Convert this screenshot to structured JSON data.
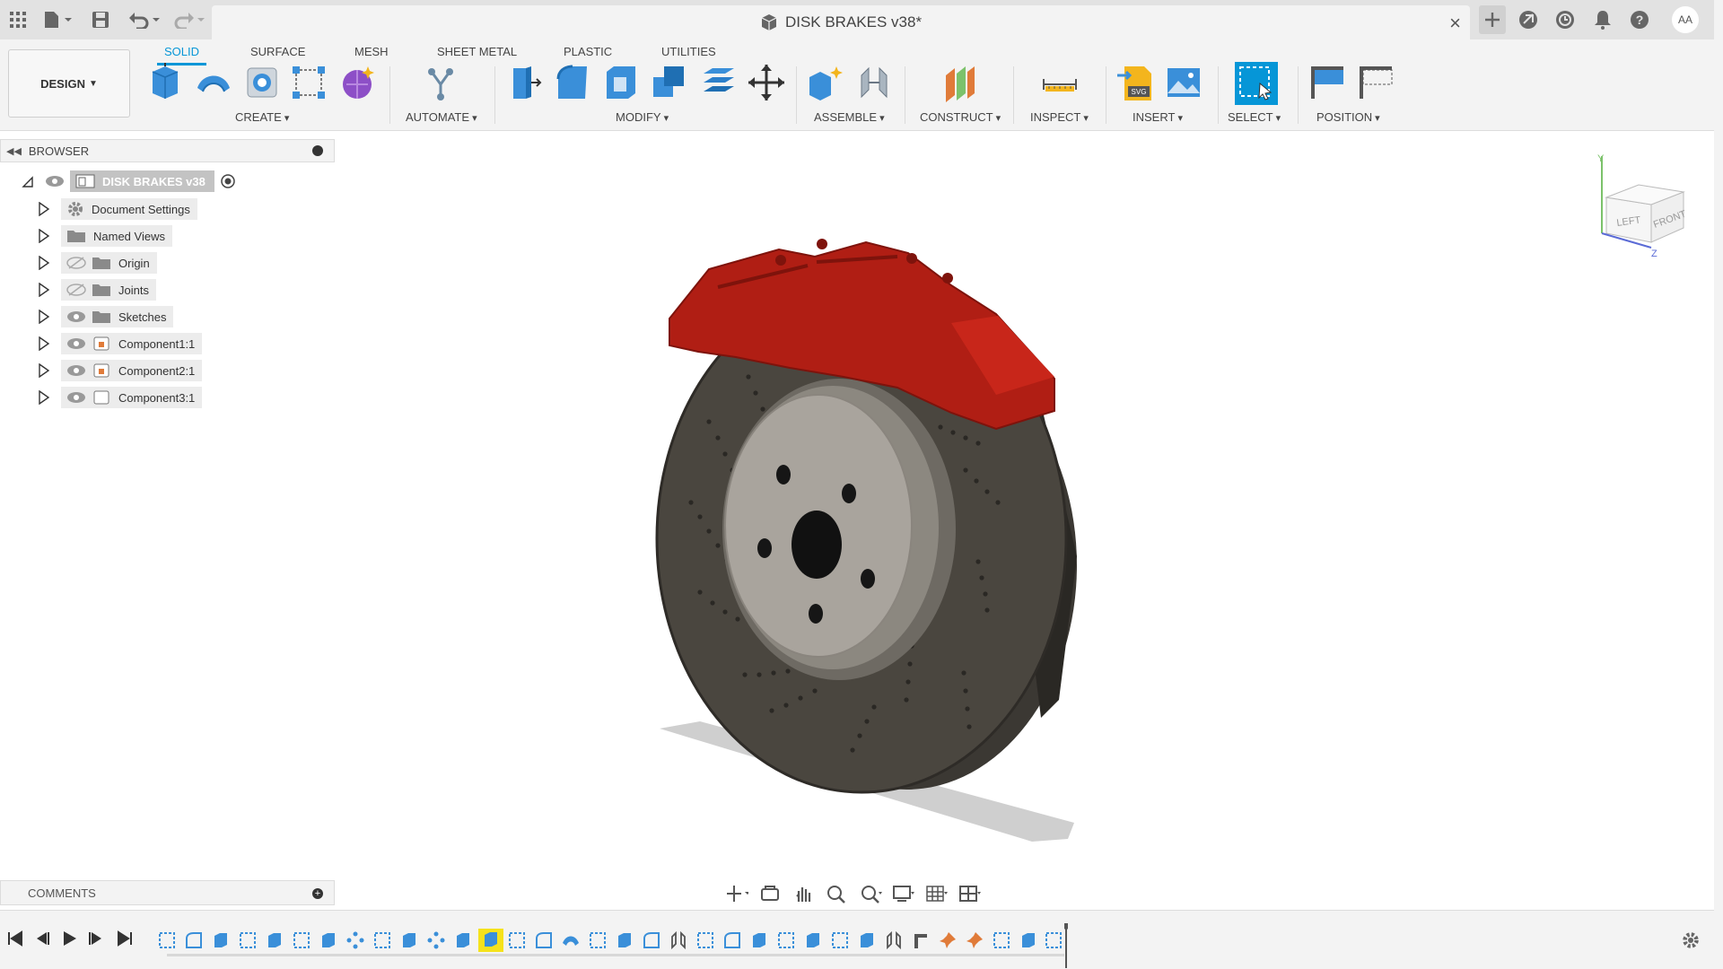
{
  "topbar": {
    "doc_title": "DISK BRAKES v38*",
    "close_label": "×",
    "avatar_initials": "AA"
  },
  "ribbon": {
    "workspace": "DESIGN",
    "tabs": [
      "SOLID",
      "SURFACE",
      "MESH",
      "SHEET METAL",
      "PLASTIC",
      "UTILITIES"
    ],
    "active_tab": "SOLID",
    "groups": [
      "CREATE",
      "AUTOMATE",
      "MODIFY",
      "ASSEMBLE",
      "CONSTRUCT",
      "INSPECT",
      "INSERT",
      "SELECT",
      "POSITION"
    ]
  },
  "browser": {
    "header": "BROWSER",
    "root": "DISK BRAKES v38",
    "items": [
      {
        "label": "Document Settings",
        "icon": "gear-icon"
      },
      {
        "label": "Named Views",
        "icon": "folder-icon"
      },
      {
        "label": "Origin",
        "icon": "folder-icon",
        "hidden": true
      },
      {
        "label": "Joints",
        "icon": "folder-icon",
        "hidden": true
      },
      {
        "label": "Sketches",
        "icon": "folder-icon"
      },
      {
        "label": "Component1:1",
        "icon": "component-icon"
      },
      {
        "label": "Component2:1",
        "icon": "component-icon"
      },
      {
        "label": "Component3:1",
        "icon": "component-icon"
      }
    ]
  },
  "viewcube": {
    "left": "LEFT",
    "front": "FRONT",
    "axis_y": "Y",
    "axis_z": "Z"
  },
  "comments": {
    "header": "COMMENTS"
  },
  "colors": {
    "accent": "#0696d7",
    "caliper": "#b01e14",
    "rotor": "#4a463f",
    "hub": "#a9a49d"
  }
}
